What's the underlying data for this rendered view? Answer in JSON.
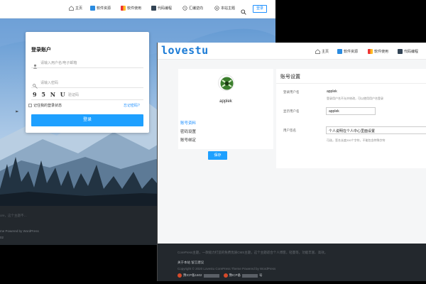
{
  "back": {
    "nav": {
      "items": [
        {
          "label": "主页",
          "icon": "home-icon"
        },
        {
          "label": "软件资源",
          "icon": "software-icon"
        },
        {
          "label": "软件使用",
          "icon": "apps-icon"
        },
        {
          "label": "代码编程",
          "icon": "code-icon"
        },
        {
          "label": "汇编逆向",
          "icon": "reverse-icon"
        },
        {
          "label": "本站主题",
          "icon": "theme-icon"
        }
      ],
      "login_label": "登录"
    },
    "login": {
      "title": "登录账户",
      "username_placeholder": "请输入用户名/电子邮箱",
      "password_placeholder": "请输入密码",
      "captcha_text": "9 5 N U",
      "captcha_placeholder": "验证码",
      "remember_label": "记住我的登录状态",
      "forgot_label": "忘记密码?",
      "submit_label": "登录"
    },
    "footer": {
      "description": "ore，这个主题不…",
      "powered": "me Powered by WordPress",
      "icp": "02"
    }
  },
  "front": {
    "logo": "lovestu",
    "nav": {
      "items": [
        {
          "label": "主页",
          "icon": "home-icon"
        },
        {
          "label": "软件资源",
          "icon": "software-icon"
        },
        {
          "label": "软件使用",
          "icon": "apps-icon"
        },
        {
          "label": "代码编程",
          "icon": "code-icon"
        }
      ]
    },
    "profile": {
      "username": "applek"
    },
    "menu": [
      {
        "label": "账号资料",
        "active": true
      },
      {
        "label": "密码设置",
        "active": false
      },
      {
        "label": "账号绑定",
        "active": false
      }
    ],
    "settings": {
      "title": "账号设置",
      "username_label": "登录用户名",
      "username_value": "applek",
      "username_hint": "登录用户名不允许修改，可以使用用户名登录",
      "nickname_label": "显示用户名",
      "nickname_value": "applek",
      "signature_label": "用户签名",
      "signature_value": "个人说明在个人中心里面设置",
      "signature_hint": "可选，签名长度200个字符，不能包含特殊字符",
      "save_label": "保存"
    },
    "footer": {
      "line1": "CorePress主题，一款极力打造的免费优质CMS主题，这个主题适合个人博客，轻量等，功能丰富、高效。",
      "links": "关于本站    留言建议",
      "copyright": "Copyright © 2020 Lovestu   CorePress Theme   Powered by WordPress",
      "icp1": "豫ICP备1602",
      "icp2": "豫ICP备",
      "icp_suffix": "号"
    }
  },
  "colors": {
    "accent": "#1ea0ff",
    "logo_blue": "#1b7bd6",
    "footer_bg": "#23282d",
    "sky_top": "#6aa0d6",
    "mountain": "#9cb6cf",
    "forest": "#1a2733"
  }
}
